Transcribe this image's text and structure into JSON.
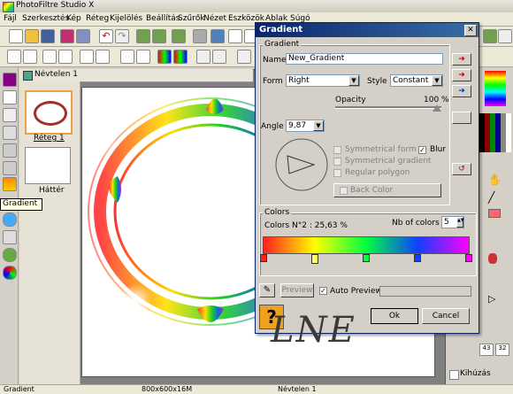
{
  "app": {
    "title": "PhotoFiltre Studio X"
  },
  "menu": [
    "Fájl",
    "Szerkesztés",
    "Kép",
    "Réteg",
    "Kijelölés",
    "Beállítás",
    "Szűrők",
    "Nézet",
    "Eszközök",
    "Ablak",
    "Súgó"
  ],
  "document": {
    "title": "Névtelen 1"
  },
  "layers": [
    {
      "label": "Réteg 1"
    },
    {
      "label": "Háttér"
    }
  ],
  "tooltip": "Gradient",
  "watermark": "LNE",
  "status": {
    "left": "Gradient",
    "size": "800x600x16M",
    "doc": "Névtelen 1"
  },
  "right_panel": {
    "kihuzas": "Kihúzás"
  },
  "dialog": {
    "title": "Gradient",
    "gradient_group": "Gradient",
    "name_label": "Name",
    "name_value": "New_Gradient",
    "form_label": "Form :",
    "form_value": "Right",
    "style_label": "Style :",
    "style_value": "Constant",
    "opacity_label": "Opacity",
    "opacity_value": "100 %",
    "angle_label": "Angle :",
    "angle_value": "9,87",
    "sym_form": "Symmetrical form",
    "sym_gradient": "Symmetrical gradient",
    "regular_polygon": "Regular polygon",
    "blur": "Blur",
    "back_color": "Back Color",
    "colors_group": "Colors",
    "colors_info": "Colors N°2 : 25,63 %",
    "nb_colors_label": "Nb of colors :",
    "nb_colors_value": "5",
    "preview": "Preview",
    "auto_preview": "Auto Preview",
    "ok": "Ok",
    "cancel": "Cancel"
  }
}
